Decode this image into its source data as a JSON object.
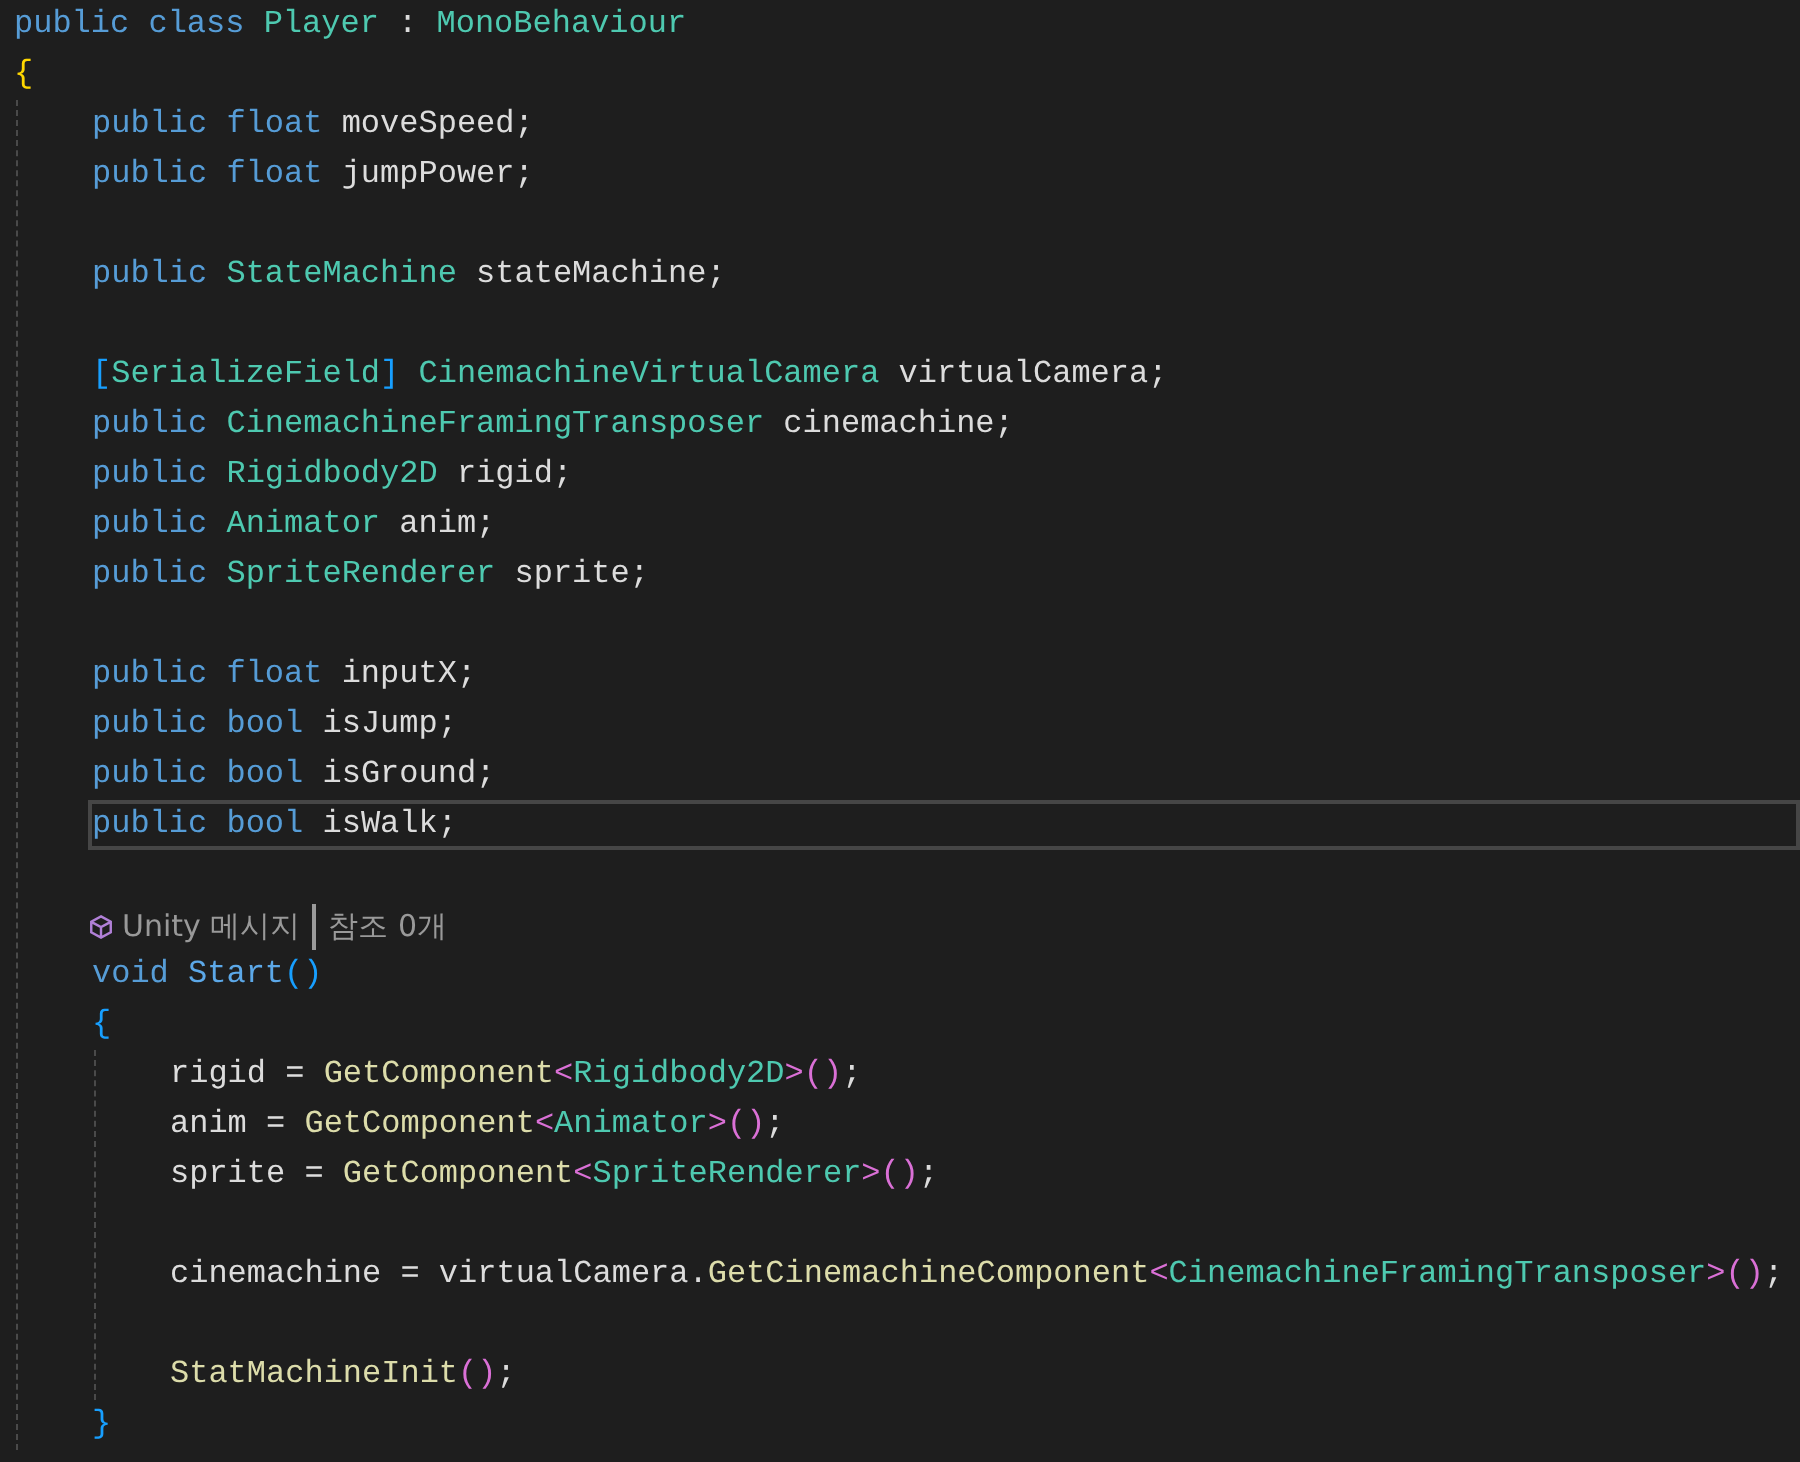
{
  "editor": {
    "lines": [
      {
        "kind": "code",
        "current": false,
        "tokens": [
          {
            "text": "public ",
            "kind": "kw"
          },
          {
            "text": "class ",
            "kind": "kw"
          },
          {
            "text": "Player",
            "kind": "type"
          },
          {
            "text": " : ",
            "kind": "p"
          },
          {
            "text": "MonoBehaviour",
            "kind": "type"
          }
        ]
      },
      {
        "kind": "code",
        "current": false,
        "tokens": [
          {
            "text": "{",
            "kind": "b1"
          }
        ],
        "children": [
          {
            "kind": "code",
            "current": false,
            "tokens": [
              {
                "text": "public ",
                "kind": "kw"
              },
              {
                "text": "float ",
                "kind": "kw"
              },
              {
                "text": "moveSpeed;",
                "kind": "id"
              }
            ]
          },
          {
            "kind": "code",
            "current": false,
            "tokens": [
              {
                "text": "public ",
                "kind": "kw"
              },
              {
                "text": "float ",
                "kind": "kw"
              },
              {
                "text": "jumpPower;",
                "kind": "id"
              }
            ]
          },
          {
            "kind": "blank"
          },
          {
            "kind": "code",
            "current": false,
            "tokens": [
              {
                "text": "public ",
                "kind": "kw"
              },
              {
                "text": "StateMachine",
                "kind": "type"
              },
              {
                "text": " stateMachine;",
                "kind": "id"
              }
            ]
          },
          {
            "kind": "blank"
          },
          {
            "kind": "code",
            "current": false,
            "tokens": [
              {
                "text": "[",
                "kind": "b2"
              },
              {
                "text": "SerializeField",
                "kind": "type"
              },
              {
                "text": "] ",
                "kind": "b2"
              },
              {
                "text": "CinemachineVirtualCamera",
                "kind": "type"
              },
              {
                "text": " virtualCamera;",
                "kind": "id"
              }
            ]
          },
          {
            "kind": "code",
            "current": false,
            "tokens": [
              {
                "text": "public ",
                "kind": "kw"
              },
              {
                "text": "CinemachineFramingTransposer",
                "kind": "type"
              },
              {
                "text": " cinemachine;",
                "kind": "id"
              }
            ]
          },
          {
            "kind": "code",
            "current": false,
            "tokens": [
              {
                "text": "public ",
                "kind": "kw"
              },
              {
                "text": "Rigidbody2D",
                "kind": "type"
              },
              {
                "text": " rigid;",
                "kind": "id"
              }
            ]
          },
          {
            "kind": "code",
            "current": false,
            "tokens": [
              {
                "text": "public ",
                "kind": "kw"
              },
              {
                "text": "Animator",
                "kind": "type"
              },
              {
                "text": " anim;",
                "kind": "id"
              }
            ]
          },
          {
            "kind": "code",
            "current": false,
            "tokens": [
              {
                "text": "public ",
                "kind": "kw"
              },
              {
                "text": "SpriteRenderer",
                "kind": "type"
              },
              {
                "text": " sprite;",
                "kind": "id"
              }
            ]
          },
          {
            "kind": "blank"
          },
          {
            "kind": "code",
            "current": false,
            "tokens": [
              {
                "text": "public ",
                "kind": "kw"
              },
              {
                "text": "float ",
                "kind": "kw"
              },
              {
                "text": "inputX;",
                "kind": "id"
              }
            ]
          },
          {
            "kind": "code",
            "current": false,
            "tokens": [
              {
                "text": "public ",
                "kind": "kw"
              },
              {
                "text": "bool ",
                "kind": "kw"
              },
              {
                "text": "isJump;",
                "kind": "id"
              }
            ]
          },
          {
            "kind": "code",
            "current": false,
            "tokens": [
              {
                "text": "public ",
                "kind": "kw"
              },
              {
                "text": "bool ",
                "kind": "kw"
              },
              {
                "text": "isGround;",
                "kind": "id"
              }
            ]
          },
          {
            "kind": "code",
            "current": true,
            "tokens": [
              {
                "text": "public ",
                "kind": "kw"
              },
              {
                "text": "bool ",
                "kind": "kw"
              },
              {
                "text": "isWalk;",
                "kind": "id"
              }
            ]
          },
          {
            "kind": "blank"
          },
          {
            "kind": "codelens",
            "items": [
              "Unity 메시지",
              "참조 0개"
            ]
          },
          {
            "kind": "code",
            "current": false,
            "tokens": [
              {
                "text": "void ",
                "kind": "kw"
              },
              {
                "text": "Start",
                "kind": "decl"
              },
              {
                "text": "()",
                "kind": "b2"
              }
            ]
          },
          {
            "kind": "code",
            "current": false,
            "tokens": [
              {
                "text": "{",
                "kind": "b2"
              }
            ],
            "children": [
              {
                "kind": "code",
                "current": false,
                "tokens": [
                  {
                    "text": "rigid = ",
                    "kind": "id"
                  },
                  {
                    "text": "GetComponent",
                    "kind": "fn"
                  },
                  {
                    "text": "<",
                    "kind": "b3"
                  },
                  {
                    "text": "Rigidbody2D",
                    "kind": "type"
                  },
                  {
                    "text": ">()",
                    "kind": "b3"
                  },
                  {
                    "text": ";",
                    "kind": "id"
                  }
                ]
              },
              {
                "kind": "code",
                "current": false,
                "tokens": [
                  {
                    "text": "anim = ",
                    "kind": "id"
                  },
                  {
                    "text": "GetComponent",
                    "kind": "fn"
                  },
                  {
                    "text": "<",
                    "kind": "b3"
                  },
                  {
                    "text": "Animator",
                    "kind": "type"
                  },
                  {
                    "text": ">()",
                    "kind": "b3"
                  },
                  {
                    "text": ";",
                    "kind": "id"
                  }
                ]
              },
              {
                "kind": "code",
                "current": false,
                "tokens": [
                  {
                    "text": "sprite = ",
                    "kind": "id"
                  },
                  {
                    "text": "GetComponent",
                    "kind": "fn"
                  },
                  {
                    "text": "<",
                    "kind": "b3"
                  },
                  {
                    "text": "SpriteRenderer",
                    "kind": "type"
                  },
                  {
                    "text": ">()",
                    "kind": "b3"
                  },
                  {
                    "text": ";",
                    "kind": "id"
                  }
                ]
              },
              {
                "kind": "blank"
              },
              {
                "kind": "code",
                "current": false,
                "tokens": [
                  {
                    "text": "cinemachine = virtualCamera.",
                    "kind": "id"
                  },
                  {
                    "text": "GetCinemachineComponent",
                    "kind": "fn"
                  },
                  {
                    "text": "<",
                    "kind": "b3"
                  },
                  {
                    "text": "CinemachineFramingTransposer",
                    "kind": "type"
                  },
                  {
                    "text": ">()",
                    "kind": "b3"
                  },
                  {
                    "text": ";",
                    "kind": "id"
                  }
                ]
              },
              {
                "kind": "blank"
              },
              {
                "kind": "code",
                "current": false,
                "tokens": [
                  {
                    "text": "StatMachineInit",
                    "kind": "fn"
                  },
                  {
                    "text": "()",
                    "kind": "b3"
                  },
                  {
                    "text": ";",
                    "kind": "id"
                  }
                ]
              }
            ]
          },
          {
            "kind": "code",
            "current": false,
            "tokens": [
              {
                "text": "}",
                "kind": "b2"
              }
            ]
          }
        ]
      }
    ]
  }
}
